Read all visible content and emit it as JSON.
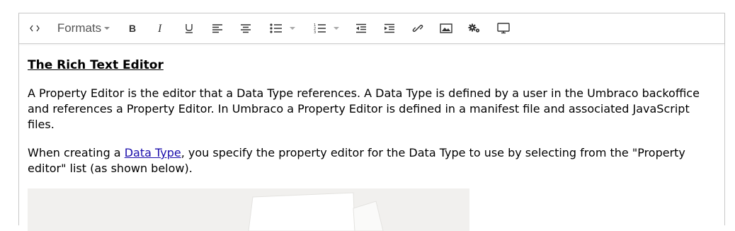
{
  "toolbar": {
    "formats_label": "Formats",
    "buttons": [
      "source-code",
      "bold",
      "italic",
      "underline",
      "align-left",
      "align-center",
      "bullet-list",
      "numbered-list",
      "outdent",
      "indent",
      "link",
      "image",
      "macro",
      "embed"
    ]
  },
  "content": {
    "heading": "The Rich Text Editor",
    "paragraph1": "A Property Editor is the editor that a Data Type references. A Data Type is defined by a user in the Umbraco backoffice and references a Property Editor. In Umbraco a Property Editor is defined in a manifest file and associated JavaScript files.",
    "paragraph2_before": "When creating a ",
    "paragraph2_link": "Data Type",
    "paragraph2_after": ", you specify the property editor for the Data Type to use by selecting from the \"Property editor\" list (as shown below)."
  },
  "colors": {
    "link": "#1a0dab",
    "border": "#c8c8c8",
    "image_bg": "#f1f0ee"
  }
}
